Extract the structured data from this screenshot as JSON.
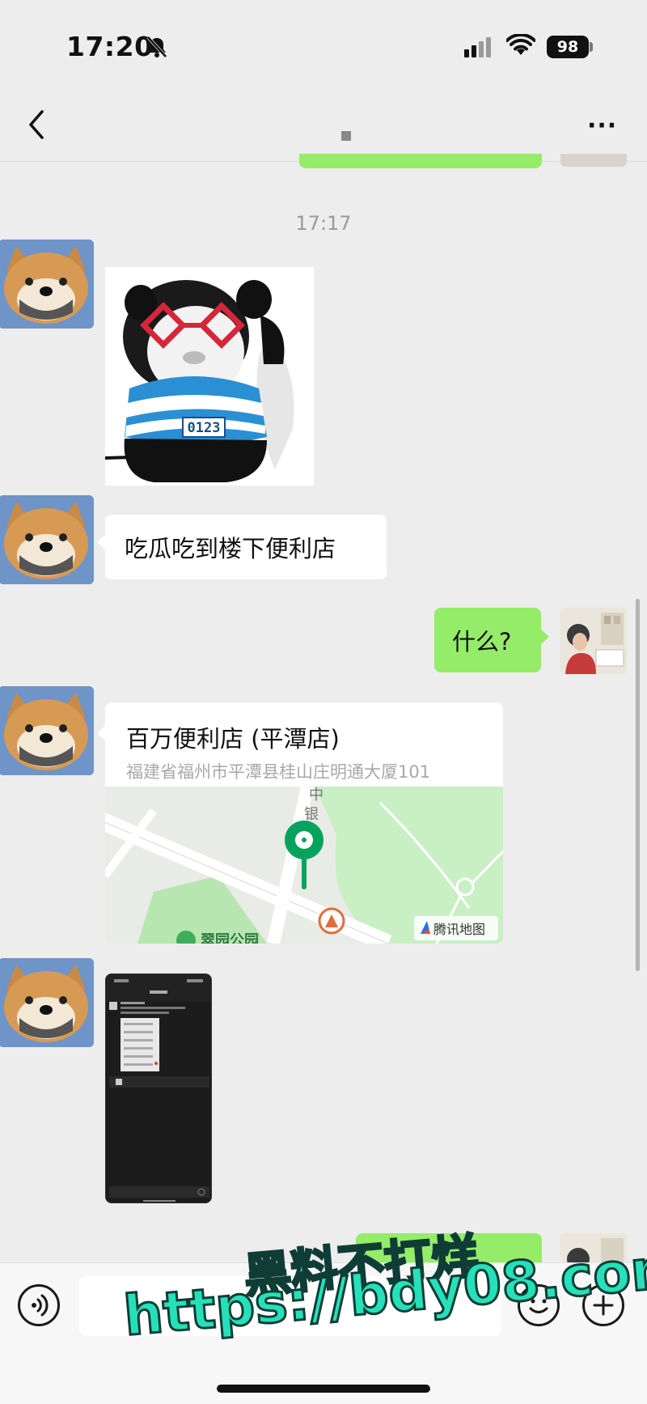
{
  "status_bar": {
    "time": "17:20",
    "battery": "98"
  },
  "nav": {
    "back_icon": "chevron-left-icon",
    "more_label": "···"
  },
  "chat": {
    "timestamp": "17:17",
    "messages": [
      {
        "side": "left",
        "type": "sticker",
        "sticker_text": "0123"
      },
      {
        "side": "left",
        "type": "text",
        "text": "吃瓜吃到楼下便利店"
      },
      {
        "side": "right",
        "type": "text",
        "text": "什么?"
      },
      {
        "side": "left",
        "type": "location",
        "name": "百万便利店 (平潭店)",
        "address": "福建省福州市平潭县桂山庄明通大厦101",
        "map_road_label_1": "中",
        "map_road_label_2": "银",
        "map_park_label": "翠园公园",
        "map_provider": "腾讯地图"
      },
      {
        "side": "left",
        "type": "image",
        "image": "phone-screenshot"
      }
    ]
  },
  "input": {
    "placeholder": "",
    "voice_icon": "voice-icon",
    "emoji_icon": "emoji-icon",
    "plus_icon": "plus-icon"
  },
  "watermark": {
    "line1": "黑料不打烊",
    "line2": "https://bdy08.com"
  },
  "colors": {
    "background": "#ededed",
    "bubble_self": "#95ec69",
    "bubble_other": "#ffffff",
    "accent_pin": "#07a35e",
    "watermark": "#26e0b9"
  }
}
